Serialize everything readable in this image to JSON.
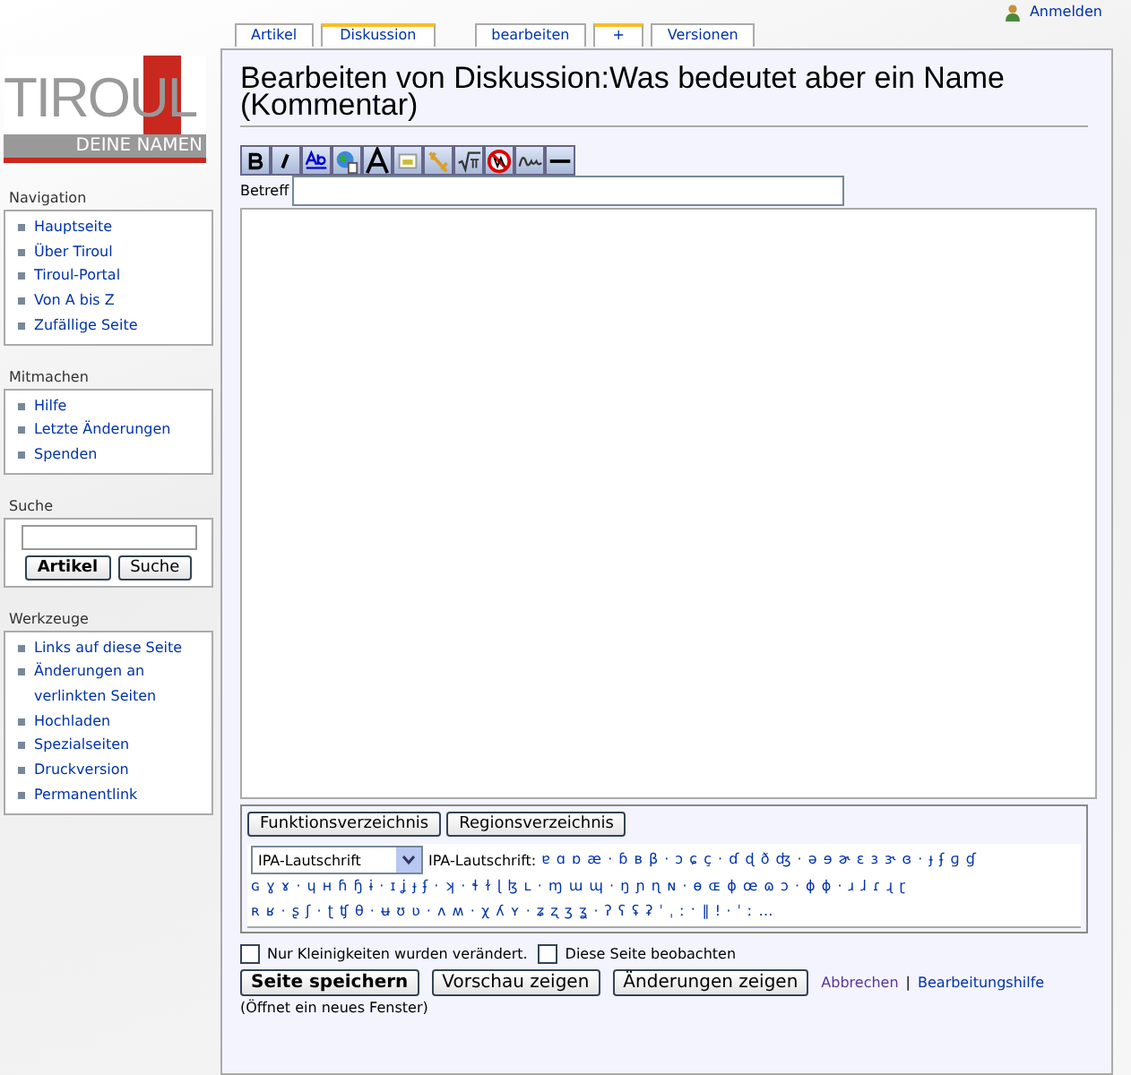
{
  "user_link": "Anmelden",
  "tabs": [
    {
      "label": "Artikel",
      "selected": false
    },
    {
      "label": "Diskussion",
      "selected": true
    },
    {
      "label": "bearbeiten",
      "selected": false
    },
    {
      "label": "+",
      "selected": true
    },
    {
      "label": "Versionen",
      "selected": false
    }
  ],
  "logo": {
    "title": "TIROUL",
    "subtitle": "DEINE NAMEN"
  },
  "sidebar": [
    {
      "kind": "links",
      "title": "Navigation",
      "items": [
        "Hauptseite",
        "Über Tiroul",
        "Tiroul-Portal",
        "Von A bis Z",
        "Zufällige Seite"
      ]
    },
    {
      "kind": "links",
      "title": "Mitmachen",
      "items": [
        "Hilfe",
        "Letzte Änderungen",
        "Spenden"
      ]
    },
    {
      "kind": "search",
      "title": "Suche",
      "buttons": [
        "Artikel",
        "Suche"
      ]
    },
    {
      "kind": "links",
      "title": "Werkzeuge",
      "items": [
        "Links auf diese Seite",
        "Änderungen an verlinkten Seiten",
        "Hochladen",
        "Spezialseiten",
        "Druckversion",
        "Permanentlink"
      ]
    }
  ],
  "heading": "Bearbeiten von Diskussion:Was bedeutet aber ein Name (Kommentar)",
  "toolbar": [
    {
      "kind": "bold"
    },
    {
      "kind": "italic"
    },
    {
      "kind": "link"
    },
    {
      "kind": "globe"
    },
    {
      "kind": "headline"
    },
    {
      "kind": "image"
    },
    {
      "kind": "media"
    },
    {
      "kind": "math"
    },
    {
      "kind": "nowiki"
    },
    {
      "kind": "signature"
    },
    {
      "kind": "hr"
    }
  ],
  "subject_label": "Betreff",
  "special_chars": {
    "buttons": [
      "Funktionsverzeichnis",
      "Regionsverzeichnis"
    ],
    "select": "IPA-Lautschrift",
    "label": "IPA-Lautschrift:",
    "lines": [
      "ɐ ɑ ɒ æ · ɓ ʙ β · ɔ ɕ ç · ɗ ɖ ð ʤ · ə ɘ ɚ ɛ ɜ ɝ ɞ · ɟ ʄ ɡ ɠ",
      "ɢ ɣ ɤ · ɥ ʜ ɦ ɧ ɨ · ɪ ʝ ɟ ʄ · ʞ · ɬ ɫ ɭ ɮ ʟ · ɱ ɯ ɰ · ŋ ɲ ɳ ɴ · ɵ ɶ ɸ œ ɷ ɔ · ɸ ɸ · ɹ ɺ ɾ ɻ ɽ",
      "ʀ ʁ · ʂ ʃ · ʈ ʧ θ · ʉ ʊ ʋ · ʌ ʍ · χ ʎ ʏ · ʑ ʐ ʒ ʓ · ʔ ʕ ʢ ʡ ˈ ˌ ː ˑ ‖ ǃ · ˈ ː …"
    ]
  },
  "checkboxes": [
    {
      "label": "Nur Kleinigkeiten wurden verändert.",
      "checked": false
    },
    {
      "label": "Diese Seite beobachten",
      "checked": false
    }
  ],
  "actions": [
    {
      "label": "Seite speichern",
      "primary": true
    },
    {
      "label": "Vorschau zeigen",
      "primary": false
    },
    {
      "label": "Änderungen zeigen",
      "primary": false
    }
  ],
  "cancel_link": "Abbrechen",
  "separator": "|",
  "help_link": "Bearbeitungshilfe",
  "help_note": "(Öffnet ein neues Fenster)"
}
